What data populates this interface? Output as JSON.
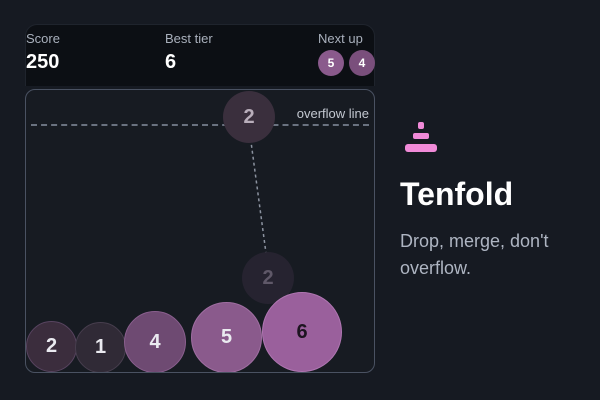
{
  "hud": {
    "score_label": "Score",
    "score_value": "250",
    "best_label": "Best tier",
    "best_value": "6",
    "next_label": "Next up",
    "next_queue": [
      "5",
      "4"
    ]
  },
  "board": {
    "overflow_label": "overflow line",
    "aim_ball": "2",
    "ghost_ball": "2",
    "balls": [
      "2",
      "1",
      "4",
      "5",
      "6"
    ]
  },
  "sidebar": {
    "title": "Tenfold",
    "subtitle": "Drop, merge, don't overflow."
  },
  "colors": {
    "background": "#161a22",
    "accent_pink": "#f08ad8",
    "ball_low": "#3a2d3c",
    "ball_mid": "#7a4f7c",
    "ball_high": "#9a609c"
  }
}
